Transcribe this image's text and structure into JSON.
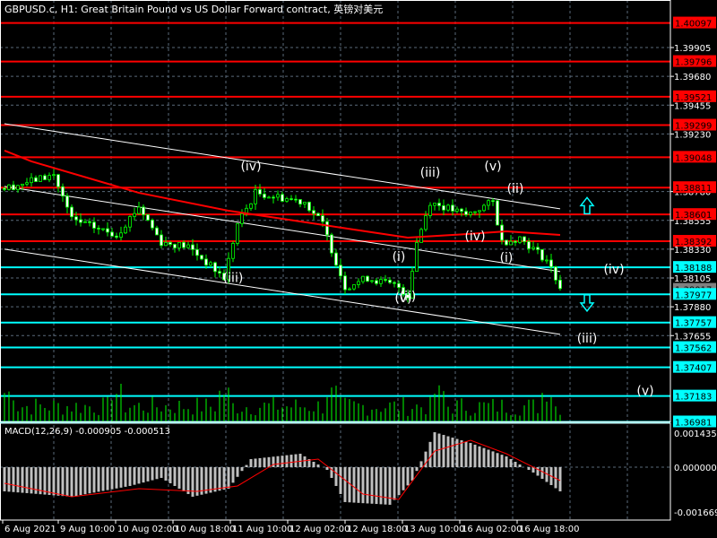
{
  "header": {
    "title": "GBPUSD.c, H1:  Great Britain Pound vs US Dollar Forward contract, 英镑对美元"
  },
  "macd_label": "MACD(12,26,9) -0.000905 -0.000513",
  "colors": {
    "up_level": "#ff0000",
    "down_level": "#00ffff",
    "candle": "#00ff00",
    "ma": "#ff0000",
    "grid": "#5a6a7a"
  },
  "chart_data": {
    "type": "candlestick",
    "symbol": "GBPUSD.c",
    "timeframe": "H1",
    "price_ticks": [
      "1.39905",
      "1.39680",
      "1.39455",
      "1.39230",
      "1.38780",
      "1.38555",
      "1.38330",
      "1.38105",
      "1.37880",
      "1.37655"
    ],
    "ylim": [
      1.3685,
      1.4028
    ],
    "current_price": "1.38017",
    "red_levels": [
      "1.40097",
      "1.39796",
      "1.39521",
      "1.39299",
      "1.39048",
      "1.38811",
      "1.38601",
      "1.38392"
    ],
    "cyan_levels": [
      "1.38188",
      "1.37977",
      "1.37757",
      "1.37562",
      "1.37407",
      "1.37183",
      "1.36981"
    ],
    "time_labels": [
      "6 Aug 2021",
      "9 Aug 10:00",
      "10 Aug 02:00",
      "10 Aug 18:00",
      "11 Aug 10:00",
      "12 Aug 02:00",
      "12 Aug 18:00",
      "13 Aug 10:00",
      "16 Aug 02:00",
      "16 Aug 18:00"
    ],
    "price_path": [
      [
        0,
        1.38805
      ],
      [
        11,
        1.3891
      ],
      [
        15,
        1.3856
      ],
      [
        25,
        1.38441
      ],
      [
        30,
        1.38665
      ],
      [
        35,
        1.38385
      ],
      [
        41,
        1.3835
      ],
      [
        49,
        1.38105
      ],
      [
        52,
        1.38525
      ],
      [
        56,
        1.3877
      ],
      [
        67,
        1.387
      ],
      [
        71,
        1.38525
      ],
      [
        76,
        1.38035
      ],
      [
        81,
        1.38105
      ],
      [
        88,
        1.38035
      ],
      [
        90,
        1.37965
      ],
      [
        92,
        1.38385
      ],
      [
        95,
        1.387
      ],
      [
        103,
        1.38595
      ],
      [
        109,
        1.387
      ],
      [
        111,
        1.38385
      ],
      [
        115,
        1.3842
      ],
      [
        121,
        1.38245
      ],
      [
        124,
        1.38035
      ]
    ],
    "ma_path": [
      [
        0,
        1.391
      ],
      [
        6,
        1.39016
      ],
      [
        30,
        1.3877
      ],
      [
        50,
        1.3863
      ],
      [
        70,
        1.38525
      ],
      [
        90,
        1.3842
      ],
      [
        100,
        1.38441
      ],
      [
        112,
        1.38469
      ],
      [
        124,
        1.38441
      ]
    ],
    "channel_lines": [
      [
        [
          0,
          1.3931
        ],
        [
          124,
          1.38645
        ]
      ],
      [
        [
          0,
          1.3882
        ],
        [
          124,
          1.38155
        ]
      ],
      [
        [
          0,
          1.3833
        ],
        [
          124,
          1.37665
        ]
      ]
    ],
    "wave_labels": [
      {
        "text": "(iv)",
        "bar": 55,
        "price": 1.38945
      },
      {
        "text": "(iii)",
        "bar": 95,
        "price": 1.38895
      },
      {
        "text": "(v)",
        "bar": 109,
        "price": 1.38945
      },
      {
        "text": "(ii)",
        "bar": 114,
        "price": 1.3877
      },
      {
        "text": "(iv)",
        "bar": 105,
        "price": 1.384
      },
      {
        "text": "(i)",
        "bar": 112,
        "price": 1.3823
      },
      {
        "text": "(i)",
        "bar": 88,
        "price": 1.38238
      },
      {
        "text": "(iii)",
        "bar": 51,
        "price": 1.38075
      },
      {
        "text": "(v)",
        "bar": 89,
        "price": 1.37915
      },
      {
        "text": "(ii)",
        "bar": 90,
        "price": 1.3793
      },
      {
        "text": "(iv)",
        "bar": 136,
        "price": 1.3814
      },
      {
        "text": "(iii)",
        "bar": 130,
        "price": 1.376
      },
      {
        "text": "(v)",
        "bar": 143,
        "price": 1.3719
      }
    ],
    "arrows": [
      {
        "dir": "up",
        "bar": 130,
        "price": 1.3867
      },
      {
        "dir": "down",
        "bar": 130,
        "price": 1.3791
      }
    ],
    "macd": {
      "ticks": [
        "0.001435",
        "0.000000",
        "-0.001669"
      ],
      "ylim": [
        -0.001669,
        0.001435
      ],
      "hist_path": [
        [
          0,
          -0.0009
        ],
        [
          15,
          -0.0011
        ],
        [
          28,
          -0.0007
        ],
        [
          35,
          -0.0004
        ],
        [
          42,
          -0.0011
        ],
        [
          50,
          -0.0008
        ],
        [
          55,
          0.0003
        ],
        [
          66,
          0.0005
        ],
        [
          72,
          -0.0001
        ],
        [
          76,
          -0.0013
        ],
        [
          86,
          -0.0014
        ],
        [
          91,
          -0.0005
        ],
        [
          96,
          0.0013
        ],
        [
          104,
          0.0009
        ],
        [
          112,
          0.0004
        ],
        [
          118,
          -0.0002
        ],
        [
          124,
          -0.0009
        ]
      ],
      "signal_path": [
        [
          0,
          -0.0006
        ],
        [
          15,
          -0.0011
        ],
        [
          30,
          -0.0008
        ],
        [
          43,
          -0.0009
        ],
        [
          52,
          -0.0007
        ],
        [
          60,
          0.0001
        ],
        [
          70,
          0.0003
        ],
        [
          80,
          -0.001
        ],
        [
          88,
          -0.0012
        ],
        [
          96,
          0.0006
        ],
        [
          104,
          0.001
        ],
        [
          112,
          0.0005
        ],
        [
          124,
          -0.0005
        ]
      ]
    }
  }
}
